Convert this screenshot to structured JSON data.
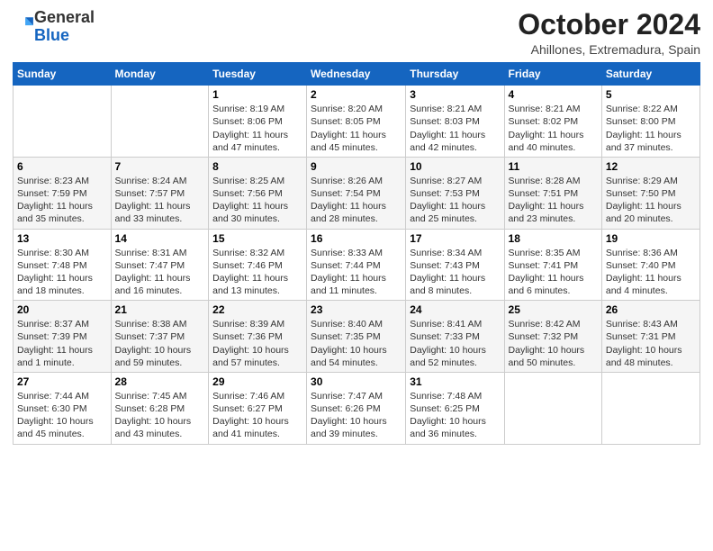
{
  "header": {
    "logo": {
      "general": "General",
      "blue": "Blue"
    },
    "title": "October 2024",
    "subtitle": "Ahillones, Extremadura, Spain"
  },
  "days_of_week": [
    "Sunday",
    "Monday",
    "Tuesday",
    "Wednesday",
    "Thursday",
    "Friday",
    "Saturday"
  ],
  "weeks": [
    [
      {
        "day": "",
        "info": ""
      },
      {
        "day": "",
        "info": ""
      },
      {
        "day": "1",
        "info": "Sunrise: 8:19 AM\nSunset: 8:06 PM\nDaylight: 11 hours and 47 minutes."
      },
      {
        "day": "2",
        "info": "Sunrise: 8:20 AM\nSunset: 8:05 PM\nDaylight: 11 hours and 45 minutes."
      },
      {
        "day": "3",
        "info": "Sunrise: 8:21 AM\nSunset: 8:03 PM\nDaylight: 11 hours and 42 minutes."
      },
      {
        "day": "4",
        "info": "Sunrise: 8:21 AM\nSunset: 8:02 PM\nDaylight: 11 hours and 40 minutes."
      },
      {
        "day": "5",
        "info": "Sunrise: 8:22 AM\nSunset: 8:00 PM\nDaylight: 11 hours and 37 minutes."
      }
    ],
    [
      {
        "day": "6",
        "info": "Sunrise: 8:23 AM\nSunset: 7:59 PM\nDaylight: 11 hours and 35 minutes."
      },
      {
        "day": "7",
        "info": "Sunrise: 8:24 AM\nSunset: 7:57 PM\nDaylight: 11 hours and 33 minutes."
      },
      {
        "day": "8",
        "info": "Sunrise: 8:25 AM\nSunset: 7:56 PM\nDaylight: 11 hours and 30 minutes."
      },
      {
        "day": "9",
        "info": "Sunrise: 8:26 AM\nSunset: 7:54 PM\nDaylight: 11 hours and 28 minutes."
      },
      {
        "day": "10",
        "info": "Sunrise: 8:27 AM\nSunset: 7:53 PM\nDaylight: 11 hours and 25 minutes."
      },
      {
        "day": "11",
        "info": "Sunrise: 8:28 AM\nSunset: 7:51 PM\nDaylight: 11 hours and 23 minutes."
      },
      {
        "day": "12",
        "info": "Sunrise: 8:29 AM\nSunset: 7:50 PM\nDaylight: 11 hours and 20 minutes."
      }
    ],
    [
      {
        "day": "13",
        "info": "Sunrise: 8:30 AM\nSunset: 7:48 PM\nDaylight: 11 hours and 18 minutes."
      },
      {
        "day": "14",
        "info": "Sunrise: 8:31 AM\nSunset: 7:47 PM\nDaylight: 11 hours and 16 minutes."
      },
      {
        "day": "15",
        "info": "Sunrise: 8:32 AM\nSunset: 7:46 PM\nDaylight: 11 hours and 13 minutes."
      },
      {
        "day": "16",
        "info": "Sunrise: 8:33 AM\nSunset: 7:44 PM\nDaylight: 11 hours and 11 minutes."
      },
      {
        "day": "17",
        "info": "Sunrise: 8:34 AM\nSunset: 7:43 PM\nDaylight: 11 hours and 8 minutes."
      },
      {
        "day": "18",
        "info": "Sunrise: 8:35 AM\nSunset: 7:41 PM\nDaylight: 11 hours and 6 minutes."
      },
      {
        "day": "19",
        "info": "Sunrise: 8:36 AM\nSunset: 7:40 PM\nDaylight: 11 hours and 4 minutes."
      }
    ],
    [
      {
        "day": "20",
        "info": "Sunrise: 8:37 AM\nSunset: 7:39 PM\nDaylight: 11 hours and 1 minute."
      },
      {
        "day": "21",
        "info": "Sunrise: 8:38 AM\nSunset: 7:37 PM\nDaylight: 10 hours and 59 minutes."
      },
      {
        "day": "22",
        "info": "Sunrise: 8:39 AM\nSunset: 7:36 PM\nDaylight: 10 hours and 57 minutes."
      },
      {
        "day": "23",
        "info": "Sunrise: 8:40 AM\nSunset: 7:35 PM\nDaylight: 10 hours and 54 minutes."
      },
      {
        "day": "24",
        "info": "Sunrise: 8:41 AM\nSunset: 7:33 PM\nDaylight: 10 hours and 52 minutes."
      },
      {
        "day": "25",
        "info": "Sunrise: 8:42 AM\nSunset: 7:32 PM\nDaylight: 10 hours and 50 minutes."
      },
      {
        "day": "26",
        "info": "Sunrise: 8:43 AM\nSunset: 7:31 PM\nDaylight: 10 hours and 48 minutes."
      }
    ],
    [
      {
        "day": "27",
        "info": "Sunrise: 7:44 AM\nSunset: 6:30 PM\nDaylight: 10 hours and 45 minutes."
      },
      {
        "day": "28",
        "info": "Sunrise: 7:45 AM\nSunset: 6:28 PM\nDaylight: 10 hours and 43 minutes."
      },
      {
        "day": "29",
        "info": "Sunrise: 7:46 AM\nSunset: 6:27 PM\nDaylight: 10 hours and 41 minutes."
      },
      {
        "day": "30",
        "info": "Sunrise: 7:47 AM\nSunset: 6:26 PM\nDaylight: 10 hours and 39 minutes."
      },
      {
        "day": "31",
        "info": "Sunrise: 7:48 AM\nSunset: 6:25 PM\nDaylight: 10 hours and 36 minutes."
      },
      {
        "day": "",
        "info": ""
      },
      {
        "day": "",
        "info": ""
      }
    ]
  ]
}
